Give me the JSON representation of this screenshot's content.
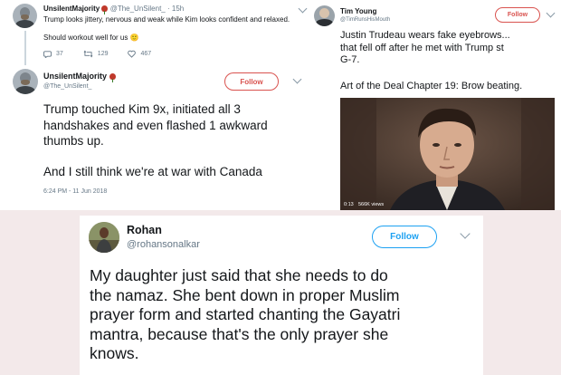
{
  "tweet1": {
    "parent": {
      "display_name": "UnsilentMajority",
      "handle": "@The_UnSilent_",
      "time": "· 15h",
      "text_line1": "Trump looks jittery, nervous and weak while Kim looks confident and relaxed.",
      "text_line2": "Should workout well for us 🙂",
      "replies": "37",
      "retweets": "129",
      "likes": "467"
    },
    "main": {
      "display_name": "UnsilentMajority",
      "handle": "@The_UnSilent_",
      "follow_label": "Follow",
      "lines": [
        "Trump touched Kim 9x, initiated all 3",
        "handshakes and even flashed 1 awkward",
        "thumbs up."
      ],
      "line_last": "And I still think we're at war with Canada",
      "timestamp": "6:24 PM - 11 Jun 2018"
    }
  },
  "tweet2": {
    "display_name": "Tim Young",
    "handle": "@TimRunsHisMouth",
    "follow_label": "Follow",
    "lines": [
      "Justin Trudeau wears fake eyebrows...",
      "that fell off after he met with Trump st",
      "G-7."
    ],
    "line_last": "Art of the Deal Chapter 19: Brow beating.",
    "video": {
      "duration": "0:13",
      "views": "566K views"
    }
  },
  "tweet3": {
    "display_name": "Rohan",
    "handle": "@rohansonalkar",
    "follow_label": "Follow",
    "lines": [
      "My daughter just said that she needs to do",
      "the namaz. She bent down in proper Muslim",
      "prayer form and started chanting the Gayatri",
      "mantra, because that's the only prayer she",
      "knows."
    ]
  },
  "colors": {
    "accent_blue": "#1da1f2",
    "follow_red": "#d9534f",
    "secondary_text": "#657786",
    "background_pink": "#f3e9ea"
  }
}
